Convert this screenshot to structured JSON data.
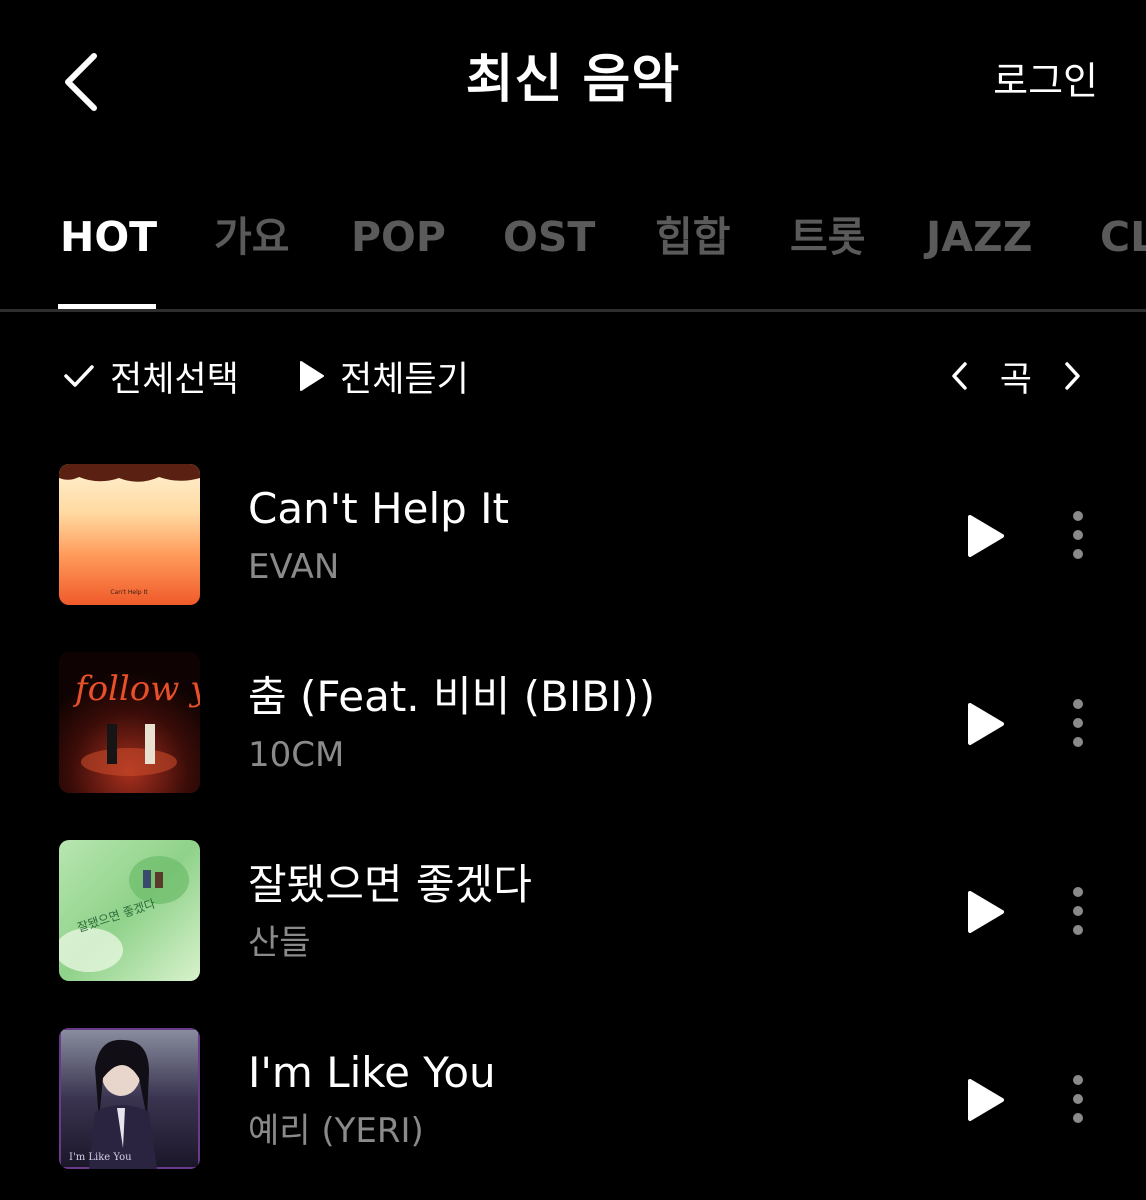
{
  "header": {
    "title": "최신 음악",
    "login_label": "로그인"
  },
  "tabs": [
    {
      "label": "HOT",
      "active": true
    },
    {
      "label": "가요",
      "active": false
    },
    {
      "label": "POP",
      "active": false
    },
    {
      "label": "OST",
      "active": false
    },
    {
      "label": "힙합",
      "active": false
    },
    {
      "label": "트롯",
      "active": false
    },
    {
      "label": "JAZZ",
      "active": false
    },
    {
      "label": "CL",
      "active": false
    }
  ],
  "toolbar": {
    "select_all_label": "전체선택",
    "play_all_label": "전체듣기",
    "unit_label": "곡"
  },
  "songs": [
    {
      "title": "Can't Help It",
      "artist": "EVAN",
      "cover_caption": "Can't Help It"
    },
    {
      "title": "춤 (Feat. 비비 (BIBI))",
      "artist": "10CM",
      "cover_caption": "follow your steps"
    },
    {
      "title": "잘됐으면 좋겠다",
      "artist": "산들",
      "cover_caption": "잘됐으면 좋겠다"
    },
    {
      "title": "I'm Like You",
      "artist": "예리 (YERI)",
      "cover_caption": "I'm Like You"
    }
  ],
  "icons": {
    "back": "chevron-left-icon",
    "select_all": "check-icon",
    "play_all": "play-icon",
    "prev_page": "chevron-left-icon",
    "next_page": "chevron-right-icon",
    "row_play": "play-icon",
    "row_more": "more-vertical-icon"
  },
  "colors": {
    "background": "#000000",
    "text_primary": "#ffffff",
    "text_secondary": "#8a8a8a",
    "tab_inactive": "#5a5a5a",
    "divider": "#2e2e2e"
  }
}
